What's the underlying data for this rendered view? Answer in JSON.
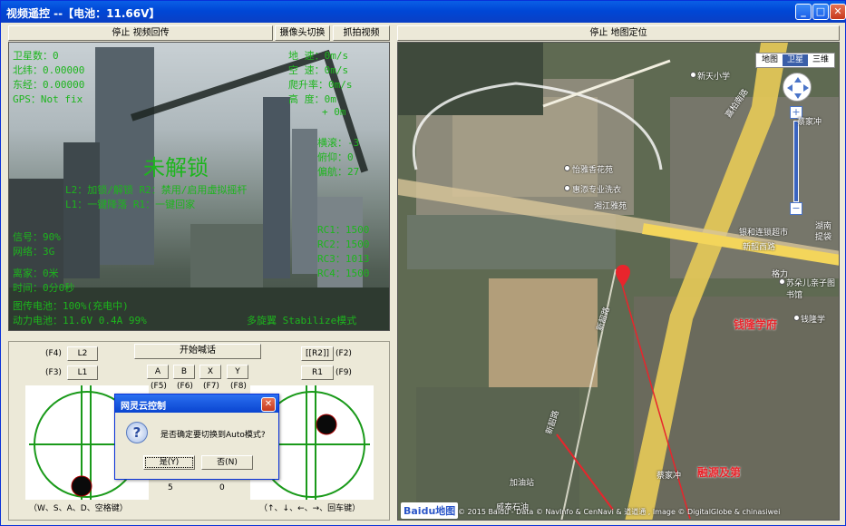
{
  "window": {
    "title": "视频遥控 --【电池：11.66V】",
    "btn_min": "_",
    "btn_max": "□",
    "btn_close": "✕"
  },
  "toolbar": {
    "stop_video": "停止 视频回传",
    "switch_camera": "摄像头切换",
    "capture_video": "抓拍视频",
    "stop_map": "停止 地图定位"
  },
  "osd": {
    "satellites": "卫星数：0",
    "latitude": "北纬：0.00000",
    "longitude": "东经：0.00000",
    "gps": "GPS：Not fix",
    "ground_speed": "地    速：0m/s",
    "air_speed": "空    速：0m/s",
    "climb_rate": "爬升率：0m/s",
    "altitude": "高    度：0m",
    "alt_delta": "+    0m",
    "roll": "横滚：-3",
    "pitch": "俯仰：0",
    "yaw": "偏航：27",
    "lock_state": "未解锁",
    "help1": "L2：加锁/解锁    R2：禁用/启用虚拟摇杆",
    "help2": "L1：一键降落    R1：一键回家",
    "signal": "信号：90%",
    "network": "网络：3G",
    "home_dist": "离家：0米",
    "time": "时间：0分0秒",
    "rc_values": [
      "RC1：1500",
      "RC2：1500",
      "RC3：1013",
      "RC4：1500"
    ],
    "video_battery": "图传电池：100%(充电中)",
    "power_battery": "动力电池：11.6V  0.4A  99%",
    "flight_mode": "多旋翼 Stabilize模式"
  },
  "controls": {
    "start_talk": "开始喊话",
    "f4": "(F4)",
    "f3": "(F3)",
    "f2": "(F2)",
    "f9": "(F9)",
    "l2": "L2",
    "l1": "L1",
    "r2": "[[R2]]",
    "r1": "R1",
    "btn_a": "A",
    "btn_b": "B",
    "btn_x": "X",
    "btn_y": "Y",
    "f5": "(F5)",
    "f6": "(F6)",
    "f7": "(F7)",
    "f8": "(F8)",
    "left_hint": "（W、S、A、D、空格键）",
    "right_hint": "（↑、↓、←、→、回车键）",
    "val_left": "5",
    "val_right": "0"
  },
  "dialog": {
    "title": "网灵云控制",
    "message": "是否确定要切换到Auto模式?",
    "yes": "是(Y)",
    "no": "否(N)",
    "close": "✕",
    "icon": "?"
  },
  "map": {
    "type_map": "地图",
    "type_satellite": "卫星",
    "type_3d": "三维",
    "labels": [
      "新天小学",
      "怡雅香花苑",
      "湘江雅苑",
      "惠添专业洗衣",
      "嘉柏南路",
      "新韶西路",
      "钱隆学府",
      "苏朵儿亲子图书馆",
      "钱隆学",
      "格力",
      "湖南",
      "提袋",
      "融源及第",
      "加油站",
      "威泰石油",
      "新韶路",
      "新韶路",
      "银和连锁超市",
      "蔡家冲",
      "蔡家冲"
    ],
    "copyright": "© 2015 Baidu - Data © NavInfo & CenNavi & 道道通 , Image © DigitalGlobe & chinasiwei",
    "logo": "Baidu地图"
  },
  "colors": {
    "osd": "#1db51d",
    "title_blue": "#0047d6",
    "pin": "#e8252c"
  }
}
